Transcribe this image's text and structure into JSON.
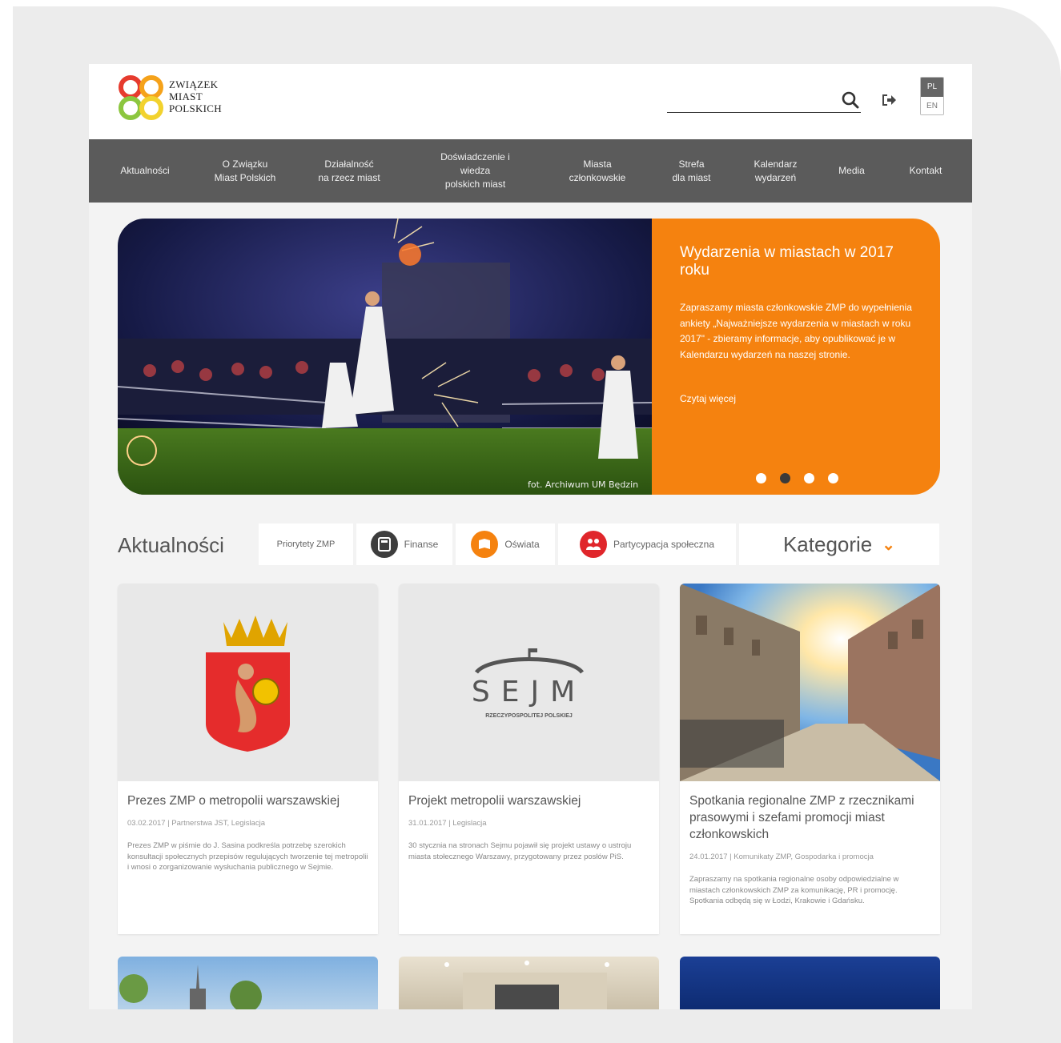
{
  "logo": {
    "line1": "ZWIĄZEK",
    "line2": "MIAST",
    "line3": "POLSKICH"
  },
  "header": {
    "search_placeholder": "",
    "lang_pl": "PL",
    "lang_en": "EN"
  },
  "nav": [
    "Aktualności",
    "O Związku\nMiast Polskich",
    "Działalność\nna rzecz miast",
    "Doświadczenie i\nwiedza\npolskich miast",
    "Miasta\nczłonkowskie",
    "Strefa\ndla miast",
    "Kalendarz\nwydarzeń",
    "Media",
    "Kontakt"
  ],
  "hero": {
    "title": "Wydarzenia w miastach w 2017 roku",
    "text": "Zapraszamy miasta członkowskie ZMP do wypełnienia ankiety „Najważniejsze wydarzenia w miastach w roku 2017\" - zbieramy informacje, aby opublikować je w Kalendarzu wydarzeń na naszej stronie.",
    "more": "Czytaj więcej",
    "credit": "fot. Archiwum UM Będzin",
    "active_dot": 1,
    "dot_count": 4
  },
  "news": {
    "heading": "Aktualności",
    "categories": [
      "Priorytety ZMP",
      "Finanse",
      "Oświata",
      "Partycypacja społeczna"
    ],
    "dropdown": "Kategorie"
  },
  "cards": [
    {
      "title": "Prezes ZMP o metropolii warszawskiej",
      "meta": "03.02.2017 | Partnerstwa JST, Legislacja",
      "text": "Prezes ZMP w piśmie do J. Sasina podkreśla potrzebę szerokich konsultacji społecznych przepisów regulujących tworzenie tej metropolii i wnosi o zorganizowanie wysłuchania publicznego w Sejmie."
    },
    {
      "title": "Projekt metropolii warszawskiej",
      "meta": "31.01.2017 | Legislacja",
      "text": "30 stycznia na stronach Sejmu pojawił się projekt ustawy o ustroju miasta stołecznego Warszawy, przygotowany przez posłów PiS.",
      "logo_main": "SEJM",
      "logo_sub": "RZECZYPOSPOLITEJ POLSKIEJ"
    },
    {
      "title": "Spotkania regionalne ZMP z rzecznikami prasowymi i szefami promocji miast członkowskich",
      "meta": "24.01.2017 | Komunikaty ZMP, Gospodarka i promocja",
      "text": "Zapraszamy na spotkania regionalne osoby odpowiedzialne w miastach członkowskich ZMP za komunikację, PR i promocję. Spotkania odbędą się w Łodzi, Krakowie i Gdańsku."
    }
  ],
  "colors": {
    "accent": "#f5820f",
    "nav": "#5b5b5b"
  }
}
